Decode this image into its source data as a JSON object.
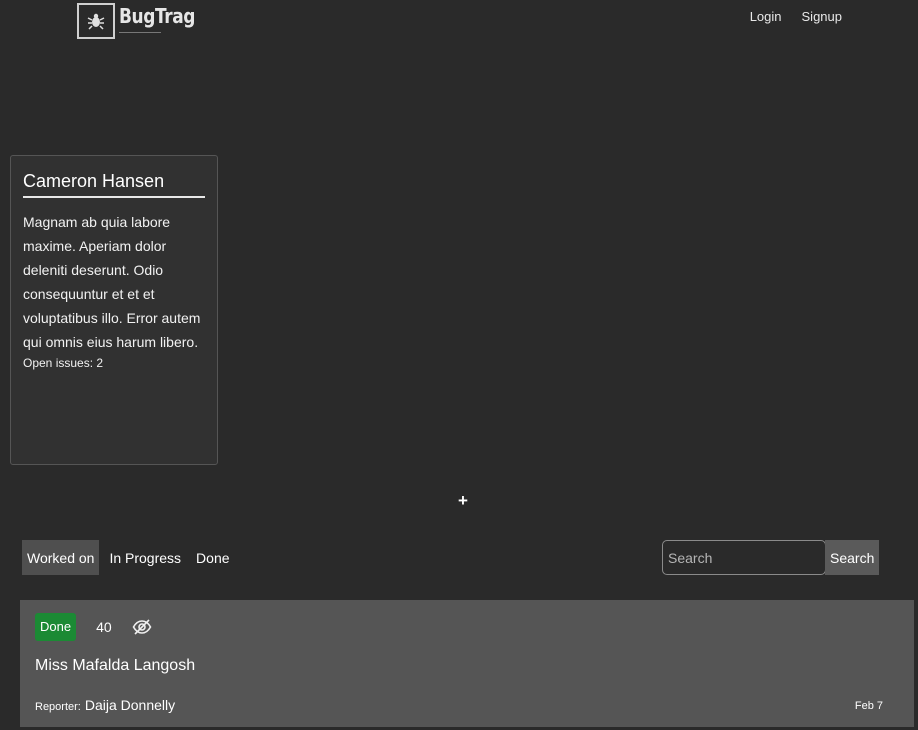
{
  "brand": {
    "name": "BugTrag",
    "icon": "bug-icon"
  },
  "nav": {
    "login": "Login",
    "signup": "Signup"
  },
  "profile": {
    "name": "Cameron Hansen",
    "description": "Magnam ab quia labore maxime. Aperiam dolor deleniti deserunt. Odio consequuntur et et et voluptatibus illo. Error autem qui omnis eius harum libero.",
    "open_issues": "Open issues: 2"
  },
  "add_button": {
    "label": "+"
  },
  "tabs": [
    {
      "label": "Worked on",
      "active": true
    },
    {
      "label": "In Progress",
      "active": false
    },
    {
      "label": "Done",
      "active": false
    }
  ],
  "search": {
    "placeholder": "Search",
    "button_label": "Search"
  },
  "issues": [
    {
      "status": "Done",
      "status_color": "#1b8a34",
      "count": "40",
      "icon": "eye-off-icon",
      "title": "Miss Mafalda Langosh",
      "reporter_label": "Reporter:",
      "reporter_name": "Daija Donnelly",
      "date": "Feb 7"
    }
  ]
}
